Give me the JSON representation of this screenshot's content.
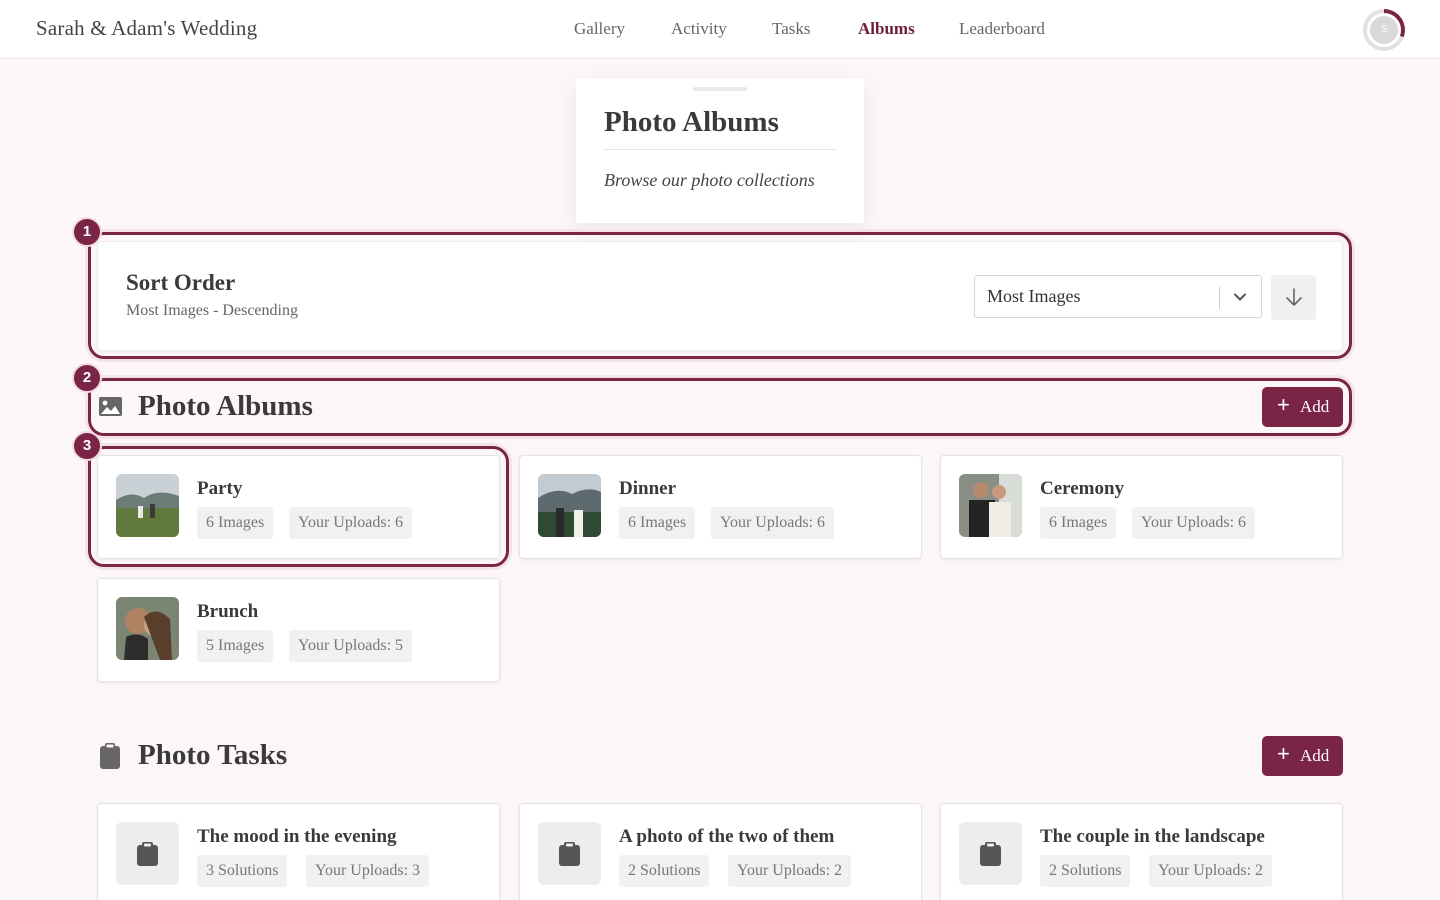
{
  "app": {
    "title": "Sarah & Adam's Wedding",
    "avatar_initial": "S"
  },
  "nav": {
    "items": [
      {
        "label": "Gallery",
        "active": false
      },
      {
        "label": "Activity",
        "active": false
      },
      {
        "label": "Tasks",
        "active": false
      },
      {
        "label": "Albums",
        "active": true
      },
      {
        "label": "Leaderboard",
        "active": false
      }
    ]
  },
  "header": {
    "title": "Photo Albums",
    "subtitle": "Browse our photo collections"
  },
  "markers": [
    "1",
    "2",
    "3"
  ],
  "sort": {
    "title": "Sort Order",
    "description": "Most Images - Descending",
    "selected": "Most Images",
    "direction": "descending"
  },
  "albums_section": {
    "title": "Photo Albums",
    "add_label": "Add",
    "albums": [
      {
        "name": "Party",
        "images": "6 Images",
        "uploads": "Your Uploads: 6"
      },
      {
        "name": "Dinner",
        "images": "6 Images",
        "uploads": "Your Uploads: 6"
      },
      {
        "name": "Ceremony",
        "images": "6 Images",
        "uploads": "Your Uploads: 6"
      },
      {
        "name": "Brunch",
        "images": "5 Images",
        "uploads": "Your Uploads: 5"
      }
    ]
  },
  "tasks_section": {
    "title": "Photo Tasks",
    "add_label": "Add",
    "tasks": [
      {
        "name": "The mood in the evening",
        "solutions": "3 Solutions",
        "uploads": "Your Uploads: 3"
      },
      {
        "name": "A photo of the two of them",
        "solutions": "2 Solutions",
        "uploads": "Your Uploads: 2"
      },
      {
        "name": "The couple in the landscape",
        "solutions": "2 Solutions",
        "uploads": "Your Uploads: 2"
      }
    ]
  },
  "colors": {
    "accent": "#7a2546",
    "page_bg": "#fcf6f6"
  }
}
